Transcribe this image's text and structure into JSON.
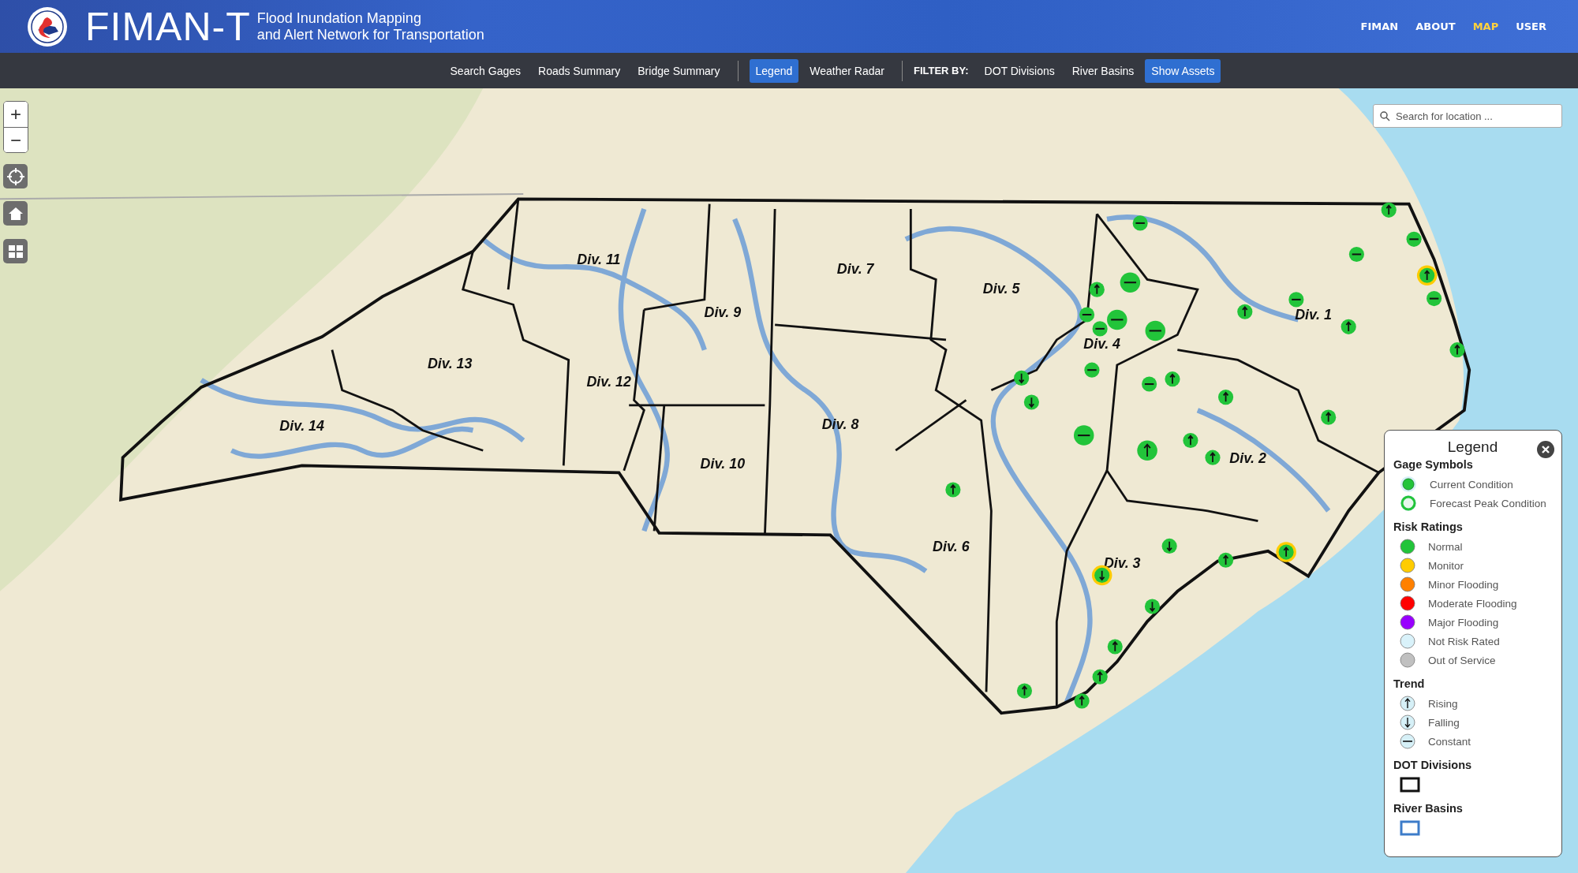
{
  "header": {
    "brand": "FIMAN-T",
    "subtitle": [
      "Flood Inundation Mapping",
      "and Alert Network for Transportation"
    ],
    "links": [
      {
        "label": "FIMAN",
        "selected": false
      },
      {
        "label": "ABOUT",
        "selected": false
      },
      {
        "label": "MAP",
        "selected": true
      },
      {
        "label": "USER",
        "selected": false
      }
    ]
  },
  "toolbar": {
    "groups": [
      {
        "items": [
          {
            "label": "Search Gages",
            "selected": false
          },
          {
            "label": "Roads Summary",
            "selected": false
          },
          {
            "label": "Bridge Summary",
            "selected": false
          }
        ]
      },
      {
        "items": [
          {
            "label": "Legend",
            "selected": true
          },
          {
            "label": "Weather Radar",
            "selected": false
          }
        ]
      },
      {
        "title": "FILTER BY:",
        "items": [
          {
            "label": "DOT Divisions",
            "selected": false
          },
          {
            "label": "River Basins",
            "selected": false
          },
          {
            "label": "Show Assets",
            "selected": true
          }
        ]
      }
    ]
  },
  "map": {
    "zoom_controls": [
      "+",
      "−"
    ],
    "search": {
      "placeholder": "Search for location ..."
    },
    "divisions": [
      "Div. 11",
      "Div. 7",
      "Div. 5",
      "Div. 9",
      "Div. 1",
      "Div. 4",
      "Div. 13",
      "Div. 12",
      "Div. 14",
      "Div. 8",
      "Div. 10",
      "Div. 2",
      "Div. 6",
      "Div. 3"
    ],
    "gages": [
      {
        "kind": "rising",
        "color": "#22c43a",
        "forecast_monitor": false
      },
      {
        "kind": "constant",
        "color": "#22c43a",
        "forecast_monitor": false
      },
      {
        "kind": "rising",
        "color": "#22c43a",
        "forecast_monitor": true
      },
      {
        "kind": "constant",
        "color": "#22c43a",
        "forecast_monitor": false
      },
      {
        "kind": "rising",
        "color": "#22c43a",
        "forecast_monitor": false
      },
      {
        "kind": "constant",
        "color": "#22c43a",
        "forecast_monitor": false
      },
      {
        "kind": "constant",
        "color": "#22c43a",
        "forecast_monitor": false
      },
      {
        "kind": "rising",
        "color": "#22c43a",
        "forecast_monitor": false
      },
      {
        "kind": "rising",
        "color": "#22c43a",
        "forecast_monitor": false
      },
      {
        "kind": "rising",
        "color": "#22c43a",
        "forecast_monitor": false
      },
      {
        "kind": "rising",
        "color": "#22c43a",
        "forecast_monitor": false
      },
      {
        "kind": "rising",
        "color": "#22c43a",
        "forecast_monitor": false
      },
      {
        "kind": "rising",
        "color": "#22c43a",
        "forecast_monitor": false
      },
      {
        "kind": "rising",
        "color": "#22c43a",
        "forecast_monitor": false
      },
      {
        "kind": "constant",
        "color": "#22c43a",
        "forecast_monitor": false
      },
      {
        "kind": "constant",
        "color": "#22c43a",
        "forecast_monitor": false
      },
      {
        "kind": "constant",
        "color": "#22c43a",
        "forecast_monitor": false
      },
      {
        "kind": "constant",
        "color": "#22c43a",
        "forecast_monitor": false
      },
      {
        "kind": "rising",
        "color": "#22c43a",
        "forecast_monitor": false
      },
      {
        "kind": "constant",
        "color": "#22c43a",
        "forecast_monitor": false
      },
      {
        "kind": "constant",
        "color": "#22c43a",
        "forecast_monitor": false
      },
      {
        "kind": "constant",
        "color": "#22c43a",
        "forecast_monitor": false
      },
      {
        "kind": "constant",
        "color": "#22c43a",
        "forecast_monitor": false
      },
      {
        "kind": "falling",
        "color": "#22c43a",
        "forecast_monitor": false
      },
      {
        "kind": "falling",
        "color": "#22c43a",
        "forecast_monitor": false
      },
      {
        "kind": "constant",
        "color": "#22c43a",
        "forecast_monitor": false
      },
      {
        "kind": "rising",
        "color": "#22c43a",
        "forecast_monitor": false
      },
      {
        "kind": "rising",
        "color": "#22c43a",
        "forecast_monitor": false
      },
      {
        "kind": "falling",
        "color": "#22c43a",
        "forecast_monitor": true
      },
      {
        "kind": "falling",
        "color": "#22c43a",
        "forecast_monitor": false
      },
      {
        "kind": "rising",
        "color": "#22c43a",
        "forecast_monitor": false
      },
      {
        "kind": "rising",
        "color": "#22c43a",
        "forecast_monitor": true
      },
      {
        "kind": "falling",
        "color": "#22c43a",
        "forecast_monitor": false
      },
      {
        "kind": "rising",
        "color": "#22c43a",
        "forecast_monitor": false
      },
      {
        "kind": "rising",
        "color": "#22c43a",
        "forecast_monitor": false
      },
      {
        "kind": "rising",
        "color": "#22c43a",
        "forecast_monitor": false
      },
      {
        "kind": "rising",
        "color": "#22c43a",
        "forecast_monitor": false
      }
    ]
  },
  "legend": {
    "title": "Legend",
    "sections": [
      {
        "title": "Gage Symbols",
        "items": [
          {
            "kind": "current",
            "label": "Current Condition"
          },
          {
            "kind": "forecast",
            "label": "Forecast Peak Condition"
          }
        ]
      },
      {
        "title": "Risk Ratings",
        "items": [
          {
            "kind": "risk",
            "label": "Normal",
            "color": "#22c43a"
          },
          {
            "kind": "risk",
            "label": "Monitor",
            "color": "#ffcc00"
          },
          {
            "kind": "risk",
            "label": "Minor Flooding",
            "color": "#ff8000"
          },
          {
            "kind": "risk",
            "label": "Moderate Flooding",
            "color": "#ff0000"
          },
          {
            "kind": "risk",
            "label": "Major Flooding",
            "color": "#9900ff"
          },
          {
            "kind": "risk",
            "label": "Not Risk Rated",
            "color": "#d9f2fa"
          },
          {
            "kind": "risk",
            "label": "Out of Service",
            "color": "#c0c0c0"
          }
        ]
      },
      {
        "title": "Trend",
        "items": [
          {
            "kind": "rising",
            "label": "Rising"
          },
          {
            "kind": "falling",
            "label": "Falling"
          },
          {
            "kind": "constant",
            "label": "Constant"
          }
        ]
      },
      {
        "title": "DOT Divisions",
        "items": [
          {
            "kind": "division"
          }
        ]
      },
      {
        "title": "River Basins",
        "items": [
          {
            "kind": "basin"
          }
        ]
      }
    ]
  }
}
